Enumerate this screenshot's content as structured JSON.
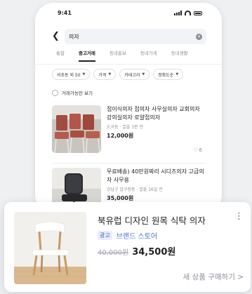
{
  "status": {
    "time": "9:41"
  },
  "search": {
    "query": "의자"
  },
  "tabs": [
    {
      "label": "통합",
      "active": false
    },
    {
      "label": "중고거래",
      "active": true
    },
    {
      "label": "동네홍보",
      "active": false
    },
    {
      "label": "동네가게",
      "active": false
    },
    {
      "label": "동네생활",
      "active": false
    }
  ],
  "filters": [
    {
      "label": "서초동 외 50"
    },
    {
      "label": "가격"
    },
    {
      "label": "카테고리"
    },
    {
      "label": "정확도순"
    }
  ],
  "available_only": {
    "label": "거래가능만 보기",
    "checked": false
  },
  "listings": [
    {
      "title": "접이식의자 접의자 사무실의자 교회의자 강의실의자 로얄접의자",
      "meta": "도곡동 · 끌올 3분 전",
      "price": "12,000원",
      "likes": "6"
    },
    {
      "title": "무료배송) 40만원짜리 시디즈의자 고급의자 사무용",
      "meta": "강남구 압구정동 · 끌올 16일 전",
      "price": "35,000원"
    }
  ],
  "ad": {
    "title": "북유럽 디자인 원목 식탁 의자",
    "badge": "광고",
    "store": "브랜드 스토어",
    "old_price": "40,000원",
    "price": "34,500원",
    "cta": "새 상품 구매하기 >"
  },
  "colors": {
    "accent_blue": "#4a74d6",
    "text": "#212124",
    "muted": "#8a8f98"
  }
}
